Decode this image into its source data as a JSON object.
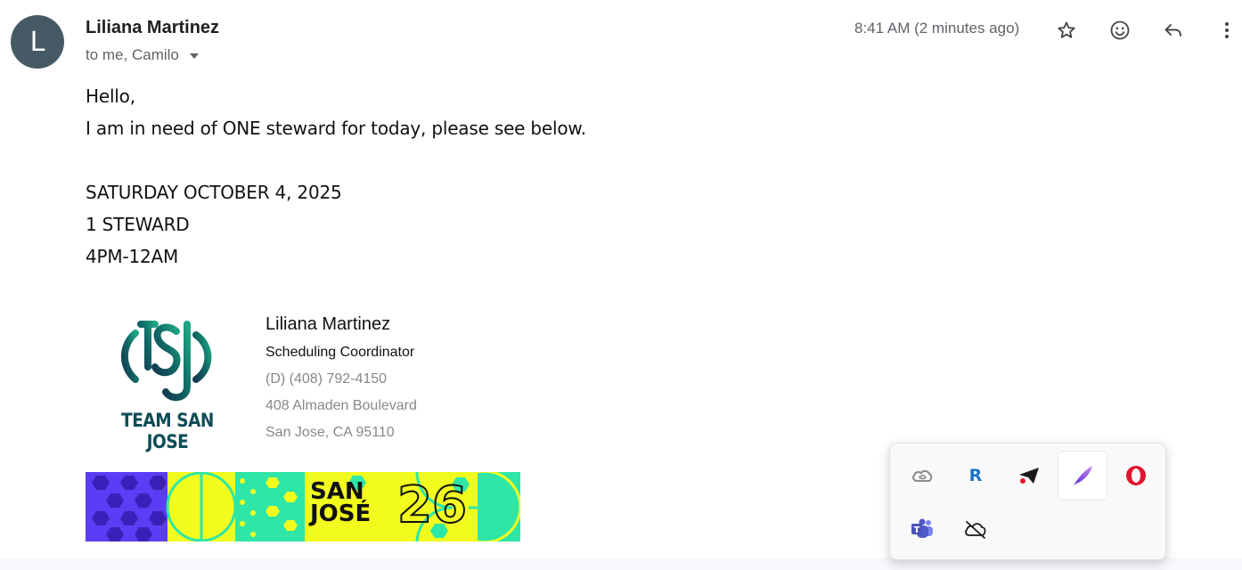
{
  "message": {
    "avatar_letter": "L",
    "sender": "Liliana Martinez",
    "recipients": "to me, Camilo",
    "timestamp": "8:41 AM (2 minutes ago)",
    "body_lines": [
      "Hello,",
      "I am in need of ONE steward for today, please see below.",
      "SATURDAY OCTOBER 4, 2025",
      "1 STEWARD",
      "4PM-12AM"
    ]
  },
  "header_icons": [
    "star-icon",
    "emoji-icon",
    "reply-icon",
    "more-vert-icon"
  ],
  "signature": {
    "logo_text": "TEAM SAN JOSE",
    "name": "Liliana Martinez",
    "title": "Scheduling Coordinator",
    "phone": "(D) (408) 792-4150",
    "address_line1": "408 Almaden Boulevard",
    "address_line2": "San Jose, CA 95110"
  },
  "banner": {
    "line1": "SAN",
    "line2": "JOSÉ",
    "number": "26",
    "colors": {
      "purple": "#5b3df5",
      "yellow": "#f2fb1e",
      "green": "#2ee6a6"
    }
  },
  "tray": {
    "icons": [
      "creative-cloud-icon",
      "r-app-icon",
      "telegram-icon",
      "quill-icon",
      "opera-icon",
      "teams-icon",
      "cloud-offline-icon"
    ],
    "r_label": "R",
    "teams_label": "T"
  },
  "colors": {
    "avatar": "#455a64",
    "logo": "#0f4c56",
    "muted": "#5f6368",
    "teams": "#5059c9",
    "opera": "#e3132d"
  }
}
